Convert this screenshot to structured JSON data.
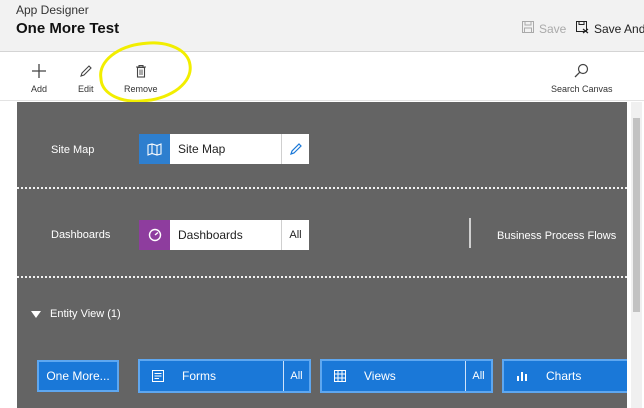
{
  "header": {
    "app_name": "App Designer",
    "app_title": "One More Test",
    "save_label": "Save",
    "save_and_label": "Save And"
  },
  "toolbar": {
    "add_label": "Add",
    "edit_label": "Edit",
    "remove_label": "Remove",
    "search_canvas_label": "Search Canvas"
  },
  "canvas": {
    "site_map_row_label": "Site Map",
    "site_map_tile_label": "Site Map",
    "dashboards_row_label": "Dashboards",
    "dashboards_tile_label": "Dashboards",
    "dashboards_all_label": "All",
    "business_process_flows_label": "Business Process Flows",
    "entity_view_label": "Entity View (1)",
    "entity_tile_label": "One More...",
    "forms_label": "Forms",
    "forms_all_label": "All",
    "views_label": "Views",
    "views_all_label": "All",
    "charts_label": "Charts"
  },
  "colors": {
    "canvas_bg": "#646464",
    "site_map_icon_bg": "#2e7fcf",
    "dashboards_icon_bg": "#8e3d9e",
    "component_blue": "#1a78d8",
    "highlight": "#f2ee00"
  },
  "icons": {
    "save": "floppy-disk-icon",
    "save_and": "save-and-close-icon",
    "add": "plus-icon",
    "edit": "pencil-icon",
    "remove": "trash-icon",
    "search": "search-icon",
    "site_map": "map-icon",
    "site_map_edit": "pencil-icon",
    "dashboards": "gauge-icon",
    "forms": "form-icon",
    "views": "grid-icon",
    "charts": "bar-chart-icon"
  }
}
